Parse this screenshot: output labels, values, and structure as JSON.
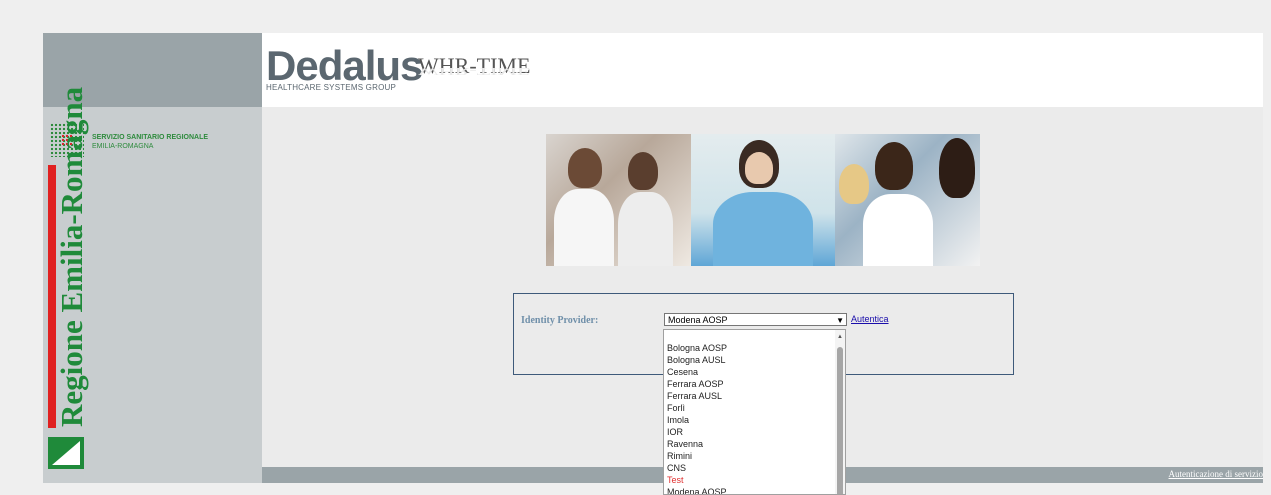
{
  "header": {
    "brand": "Dedalus",
    "brand_sub": "HEALTHCARE SYSTEMS GROUP",
    "app_title": "WHR-TIME"
  },
  "sidebar": {
    "ssr_line1": "SERVIZIO SANITARIO REGIONALE",
    "ssr_line2": "EMILIA-ROMAGNA",
    "region_name": "Regione Emilia-Romagna"
  },
  "login": {
    "label": "Identity Provider:",
    "selected": "Modena AOSP",
    "auth_link": "Autentica"
  },
  "dropdown": {
    "options": [
      "Bologna AOSP",
      "Bologna AUSL",
      "Cesena",
      "Ferrara AOSP",
      "Ferrara AUSL",
      "Forlì",
      "Imola",
      "IOR",
      "Ravenna",
      "Rimini",
      "CNS",
      "Test",
      "Modena AOSP"
    ]
  },
  "footer": {
    "link": "Autenticazione di servizio"
  },
  "colors": {
    "accent_link": "#1a0dab",
    "green": "#1f8a3a",
    "red": "#e02020",
    "test_option": "#e03030"
  }
}
